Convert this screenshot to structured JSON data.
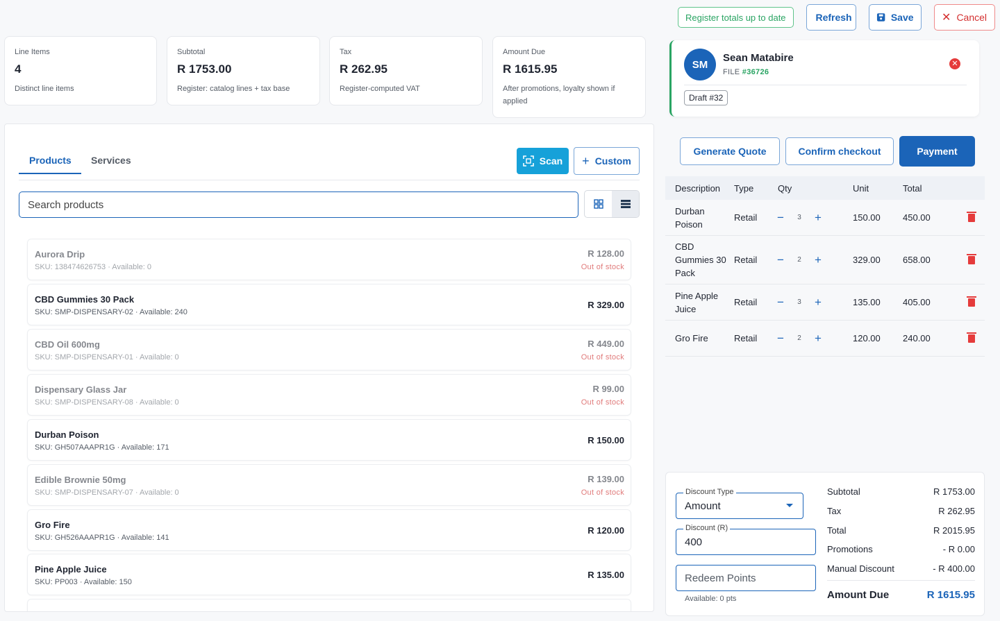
{
  "top_actions": {
    "register_totals": "Register totals up to date",
    "refresh": "Refresh",
    "save": "Save",
    "cancel": "Cancel"
  },
  "kpis": [
    {
      "label": "Line Items",
      "value": "4",
      "sub": "Distinct line items"
    },
    {
      "label": "Subtotal",
      "value": "R 1753.00",
      "sub": "Register: catalog lines + tax base"
    },
    {
      "label": "Tax",
      "value": "R 262.95",
      "sub": "Register-computed VAT"
    },
    {
      "label": "Amount Due",
      "value": "R 1615.95",
      "sub": "After promotions, loyalty shown if applied"
    }
  ],
  "customer": {
    "initials": "SM",
    "name": "Sean Matabire",
    "file_label": "FILE",
    "file_number": "#36726",
    "draft": "Draft #32"
  },
  "checkout": {
    "generate_quote": "Generate Quote",
    "confirm_checkout": "Confirm checkout",
    "payment": "Payment"
  },
  "cart": {
    "headers": {
      "description": "Description",
      "type": "Type",
      "qty": "Qty",
      "unit": "Unit",
      "total": "Total"
    },
    "rows": [
      {
        "description": "Durban Poison",
        "type": "Retail",
        "qty": "3",
        "unit": "150.00",
        "total": "450.00"
      },
      {
        "description": "CBD Gummies 30 Pack",
        "type": "Retail",
        "qty": "2",
        "unit": "329.00",
        "total": "658.00"
      },
      {
        "description": "Pine Apple Juice",
        "type": "Retail",
        "qty": "3",
        "unit": "135.00",
        "total": "405.00"
      },
      {
        "description": "Gro Fire",
        "type": "Retail",
        "qty": "2",
        "unit": "120.00",
        "total": "240.00"
      }
    ]
  },
  "discount": {
    "type_label": "Discount Type",
    "type_value": "Amount",
    "amount_label": "Discount (R)",
    "amount_value": "400",
    "redeem_points": "Redeem Points",
    "available_points": "Available: 0 pts"
  },
  "totals": {
    "subtotal_label": "Subtotal",
    "subtotal": "R 1753.00",
    "tax_label": "Tax",
    "tax": "R 262.95",
    "total_label": "Total",
    "total": "R 2015.95",
    "promotions_label": "Promotions",
    "promotions": "- R 0.00",
    "manual_discount_label": "Manual Discount",
    "manual_discount": "- R 400.00",
    "amount_due_label": "Amount Due",
    "amount_due": "R 1615.95"
  },
  "products_panel": {
    "tabs": [
      "Products",
      "Services"
    ],
    "scan": "Scan",
    "custom": "Custom",
    "search_placeholder": "Search products",
    "out_of_stock_label": "Out of stock",
    "items": [
      {
        "name": "Aurora Drip",
        "sku": "SKU: 138474626753 · Available: 0",
        "price": "R 128.00",
        "out_of_stock": true
      },
      {
        "name": "CBD Gummies 30 Pack",
        "sku": "SKU: SMP-DISPENSARY-02 · Available: 240",
        "price": "R 329.00",
        "out_of_stock": false
      },
      {
        "name": "CBD Oil 600mg",
        "sku": "SKU: SMP-DISPENSARY-01 · Available: 0",
        "price": "R 449.00",
        "out_of_stock": true
      },
      {
        "name": "Dispensary Glass Jar",
        "sku": "SKU: SMP-DISPENSARY-08 · Available: 0",
        "price": "R 99.00",
        "out_of_stock": true
      },
      {
        "name": "Durban Poison",
        "sku": "SKU: GH507AAAPR1G · Available: 171",
        "price": "R 150.00",
        "out_of_stock": false
      },
      {
        "name": "Edible Brownie 50mg",
        "sku": "SKU: SMP-DISPENSARY-07 · Available: 0",
        "price": "R 139.00",
        "out_of_stock": true
      },
      {
        "name": "Gro Fire",
        "sku": "SKU: GH526AAAPR1G · Available: 141",
        "price": "R 120.00",
        "out_of_stock": false
      },
      {
        "name": "Pine Apple Juice",
        "sku": "SKU: PP003 · Available: 150",
        "price": "R 135.00",
        "out_of_stock": false
      }
    ]
  },
  "colors": {
    "primary": "#1b64b8",
    "success": "#2aa463",
    "danger": "#e53b3b",
    "scan": "#16a1d9"
  }
}
